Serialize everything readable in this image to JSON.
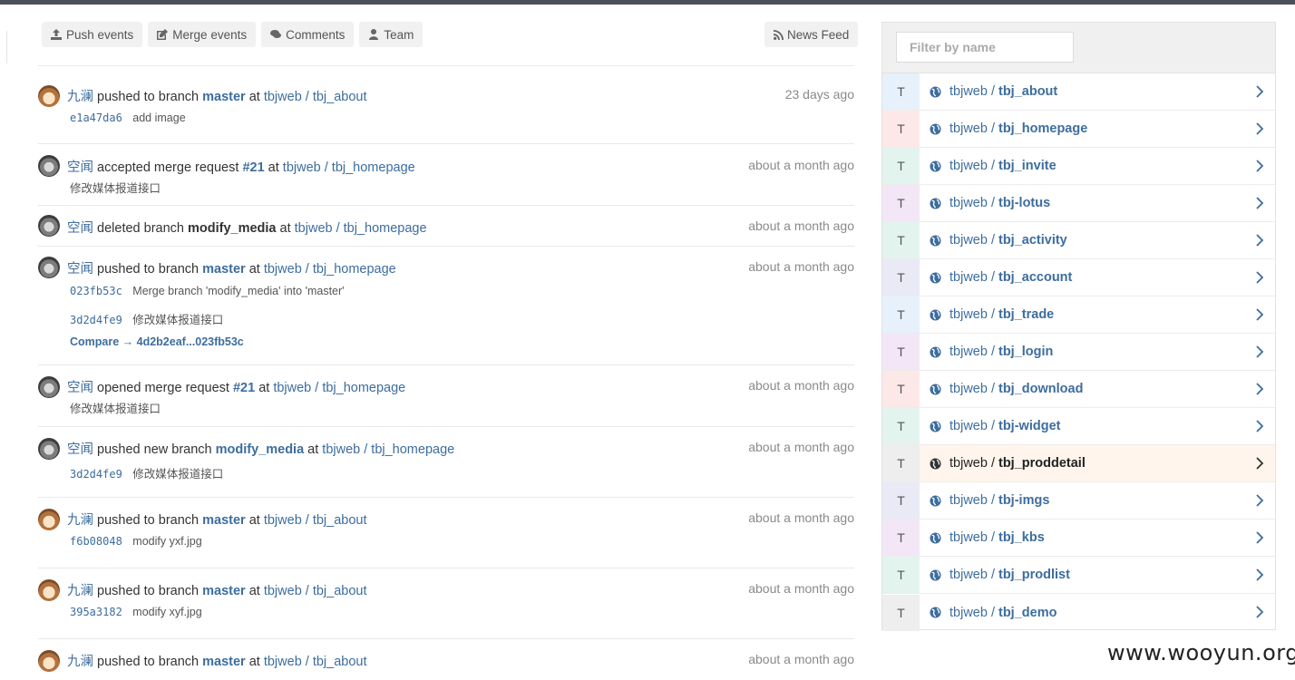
{
  "tabs": [
    {
      "label": "Push events",
      "icon": "upload-icon"
    },
    {
      "label": "Merge events",
      "icon": "edit-icon"
    },
    {
      "label": "Comments",
      "icon": "comments-icon"
    },
    {
      "label": "Team",
      "icon": "user-icon"
    }
  ],
  "news_feed": {
    "label": "News Feed",
    "icon": "rss-icon"
  },
  "events": [
    {
      "user": "九澜",
      "action": "pushed to branch",
      "ref": "master",
      "at": "at",
      "project": "tbjweb / tbj_about",
      "time": "23 days ago",
      "commits": [
        {
          "sha": "e1a47da6",
          "message": "add image"
        }
      ]
    },
    {
      "user": "空闻",
      "action": "accepted merge request",
      "ref": "#21",
      "at": "at",
      "project": "tbjweb / tbj_homepage",
      "time": "about a month ago",
      "note": "修改媒体报道接口"
    },
    {
      "user": "空闻",
      "action": "deleted branch",
      "ref": "modify_media",
      "at": "at",
      "project": "tbjweb / tbj_homepage",
      "time": "about a month ago"
    },
    {
      "user": "空闻",
      "action": "pushed to branch",
      "ref": "master",
      "at": "at",
      "project": "tbjweb / tbj_homepage",
      "time": "about a month ago",
      "commits": [
        {
          "sha": "023fb53c",
          "message": "Merge branch 'modify_media' into 'master'"
        },
        {
          "sha": "3d2d4fe9",
          "message": "修改媒体报道接口"
        }
      ],
      "compare": "Compare → 4d2b2eaf...023fb53c"
    },
    {
      "user": "空闻",
      "action": "opened merge request",
      "ref": "#21",
      "at": "at",
      "project": "tbjweb / tbj_homepage",
      "time": "about a month ago",
      "note": "修改媒体报道接口"
    },
    {
      "user": "空闻",
      "action": "pushed new branch",
      "ref": "modify_media",
      "at": "at",
      "project": "tbjweb / tbj_homepage",
      "time": "about a month ago",
      "commits": [
        {
          "sha": "3d2d4fe9",
          "message": "修改媒体报道接口"
        }
      ]
    },
    {
      "user": "九澜",
      "action": "pushed to branch",
      "ref": "master",
      "at": "at",
      "project": "tbjweb / tbj_about",
      "time": "about a month ago",
      "commits": [
        {
          "sha": "f6b08048",
          "message": "modify yxf.jpg"
        }
      ]
    },
    {
      "user": "九澜",
      "action": "pushed to branch",
      "ref": "master",
      "at": "at",
      "project": "tbjweb / tbj_about",
      "time": "about a month ago",
      "commits": [
        {
          "sha": "395a3182",
          "message": "modify xyf.jpg"
        }
      ]
    },
    {
      "user": "九澜",
      "action": "pushed to branch",
      "ref": "master",
      "at": "at",
      "project": "tbjweb / tbj_about",
      "time": "about a month ago"
    }
  ],
  "sidebar": {
    "filter_placeholder": "Filter by name",
    "projects": [
      {
        "letter": "T",
        "ns": "tbjweb / ",
        "repo": "tbj_about",
        "color": "#e6f1fb"
      },
      {
        "letter": "T",
        "ns": "tbjweb / ",
        "repo": "tbj_homepage",
        "color": "#fde8e8"
      },
      {
        "letter": "T",
        "ns": "tbjweb / ",
        "repo": "tbj_invite",
        "color": "#e3f4ef"
      },
      {
        "letter": "T",
        "ns": "tbjweb / ",
        "repo": "tbj-lotus",
        "color": "#f3e6f6"
      },
      {
        "letter": "T",
        "ns": "tbjweb / ",
        "repo": "tbj_activity",
        "color": "#e3f4ef"
      },
      {
        "letter": "T",
        "ns": "tbjweb / ",
        "repo": "tbj_account",
        "color": "#e9eaf6"
      },
      {
        "letter": "T",
        "ns": "tbjweb / ",
        "repo": "tbj_trade",
        "color": "#e6f1fb"
      },
      {
        "letter": "T",
        "ns": "tbjweb / ",
        "repo": "tbj_login",
        "color": "#f3e6f6"
      },
      {
        "letter": "T",
        "ns": "tbjweb / ",
        "repo": "tbj_download",
        "color": "#fde8e8"
      },
      {
        "letter": "T",
        "ns": "tbjweb / ",
        "repo": "tbj-widget",
        "color": "#e3f4ef"
      },
      {
        "letter": "T",
        "ns": "tbjweb / ",
        "repo": "tbj_proddetail",
        "color": "#eeeeee",
        "active": true
      },
      {
        "letter": "T",
        "ns": "tbjweb / ",
        "repo": "tbj-imgs",
        "color": "#e9eaf6"
      },
      {
        "letter": "T",
        "ns": "tbjweb / ",
        "repo": "tbj_kbs",
        "color": "#f3e6f6"
      },
      {
        "letter": "T",
        "ns": "tbjweb / ",
        "repo": "tbj_prodlist",
        "color": "#e3f4ef"
      },
      {
        "letter": "T",
        "ns": "tbjweb / ",
        "repo": "tbj_demo",
        "color": "#eeeeee"
      }
    ]
  },
  "watermark": "www.wooyun.org"
}
